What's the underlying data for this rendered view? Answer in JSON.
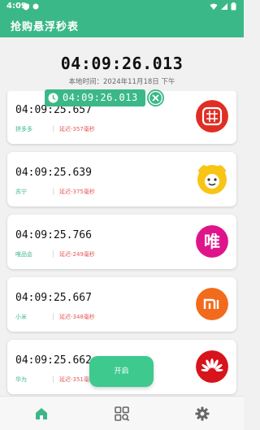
{
  "status_bar": {
    "time": "4:09"
  },
  "app_bar": {
    "title": "抢购悬浮秒表"
  },
  "clock": {
    "time": "04:09:26.013",
    "local_time": "本地时间：2024年11月18日 下午"
  },
  "float_timer": {
    "time": "04:09:26.013"
  },
  "platforms": [
    {
      "time": "04:09:25.657",
      "name": "拼多多",
      "delay": "延迟-357毫秒",
      "logo_icon": "pinduoduo-logo-icon",
      "logo_color": "#e02e24"
    },
    {
      "time": "04:09:25.639",
      "name": "苏宁",
      "delay": "延迟-375毫秒",
      "logo_icon": "suning-logo-icon",
      "logo_color": "#f8c517"
    },
    {
      "time": "04:09:25.766",
      "name": "唯品会",
      "delay": "延迟-249毫秒",
      "logo_icon": "vipshop-logo-icon",
      "logo_color": "#e0148a",
      "logo_text": "唯"
    },
    {
      "time": "04:09:25.667",
      "name": "小米",
      "delay": "延迟-348毫秒",
      "logo_icon": "xiaomi-logo-icon",
      "logo_color": "#f26b1d",
      "logo_text": "mi"
    },
    {
      "time": "04:09:25.662",
      "name": "华为",
      "delay": "延迟-351毫秒",
      "logo_icon": "huawei-logo-icon",
      "logo_color": "#d7131c"
    }
  ],
  "start_button": {
    "label": "开启"
  },
  "bottom_nav": [
    {
      "icon": "home-icon",
      "active": true
    },
    {
      "icon": "apps-search-icon",
      "active": false
    },
    {
      "icon": "settings-gear-icon",
      "active": false
    }
  ],
  "colors": {
    "accent": "#3bb888",
    "delay": "#e45a5a"
  }
}
